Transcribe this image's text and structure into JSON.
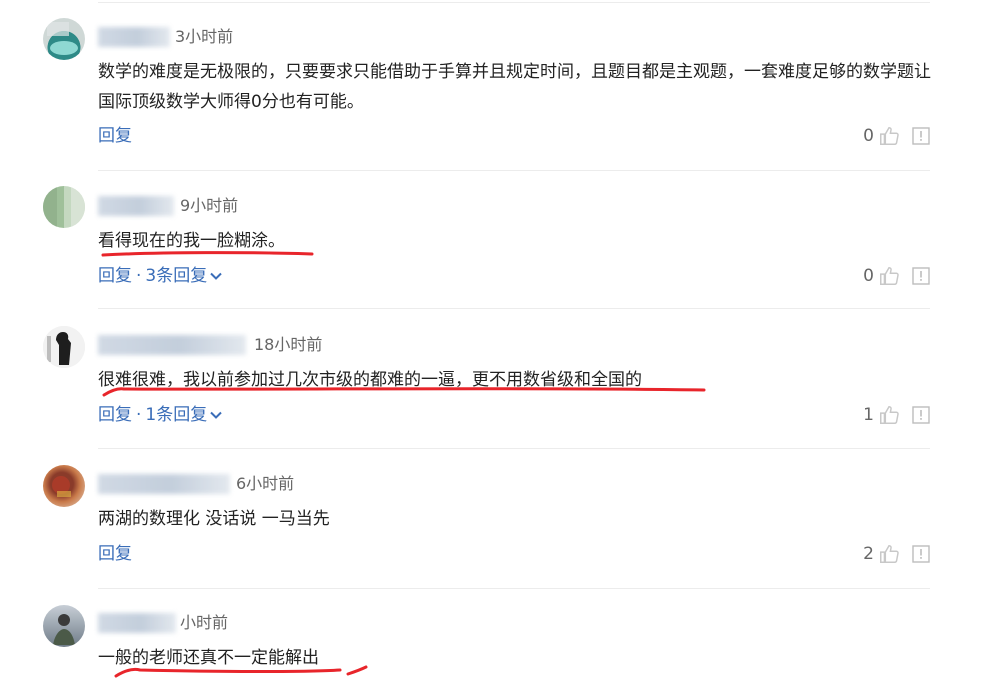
{
  "comments": [
    {
      "time": "3小时前",
      "content": "数学的难度是无极限的，只要要求只能借助于手算并且规定时间，且题目都是主观题，一套难度足够的数学题让国际顶级数学大师得0分也有可能。",
      "reply_label": "回复",
      "reply_count": "",
      "likes": "0"
    },
    {
      "time": "9小时前",
      "content": "看得现在的我一脸糊涂。",
      "reply_label": "回复",
      "reply_count": "3条回复",
      "likes": "0"
    },
    {
      "time": "18小时前",
      "content": "很难很难，我以前参加过几次市级的都难的一逼，更不用数省级和全国的",
      "reply_label": "回复",
      "reply_count": "1条回复",
      "likes": "1"
    },
    {
      "time": "6小时前",
      "content": "两湖的数理化 没话说 一马当先",
      "reply_label": "回复",
      "reply_count": "",
      "likes": "2"
    },
    {
      "time": "小时前",
      "content": "一般的老师还真不一定能解出",
      "reply_label": "",
      "reply_count": "",
      "likes": ""
    }
  ],
  "separator_dot": "·",
  "icons": {
    "like": "thumbs-up-icon",
    "report": "report-icon",
    "expand": "chevron-down-icon"
  },
  "colors": {
    "link": "#3a6db8",
    "annotation": "#e8252b",
    "muted": "#666666"
  }
}
